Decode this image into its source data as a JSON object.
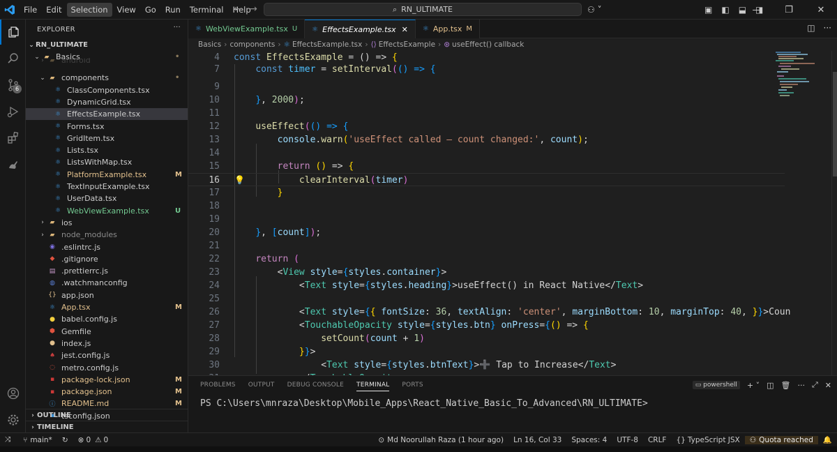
{
  "window": {
    "menu": [
      "File",
      "Edit",
      "Selection",
      "View",
      "Go",
      "Run",
      "Terminal",
      "Help"
    ],
    "menu_active": "Selection",
    "command_center": "RN_ULTIMATE"
  },
  "activity_bar": {
    "source_control_badge": "6"
  },
  "sidebar": {
    "title": "EXPLORER",
    "root": "RN_ULTIMATE",
    "items": [
      {
        "label": "Basics",
        "status": "•",
        "kind": "folder",
        "state": "open"
      },
      {
        "label": "android",
        "status": "",
        "kind": "folder",
        "state": "closed"
      },
      {
        "label": "components",
        "status": "•",
        "kind": "folder",
        "state": "open"
      },
      {
        "label": "ClassComponents.tsx",
        "status": "",
        "kind": "tsx"
      },
      {
        "label": "DynamicGrid.tsx",
        "status": "",
        "kind": "tsx"
      },
      {
        "label": "EffectsExample.tsx",
        "status": "",
        "kind": "tsx"
      },
      {
        "label": "Forms.tsx",
        "status": "",
        "kind": "tsx"
      },
      {
        "label": "GridItem.tsx",
        "status": "",
        "kind": "tsx"
      },
      {
        "label": "Lists.tsx",
        "status": "",
        "kind": "tsx"
      },
      {
        "label": "ListsWithMap.tsx",
        "status": "",
        "kind": "tsx"
      },
      {
        "label": "PlatformExample.tsx",
        "status": "M",
        "kind": "tsx"
      },
      {
        "label": "TextInputExample.tsx",
        "status": "",
        "kind": "tsx"
      },
      {
        "label": "UserData.tsx",
        "status": "",
        "kind": "tsx"
      },
      {
        "label": "WebViewExample.tsx",
        "status": "U",
        "kind": "tsx"
      },
      {
        "label": "ios",
        "status": "",
        "kind": "folder",
        "state": "closed"
      },
      {
        "label": "node_modules",
        "status": "",
        "kind": "folder",
        "state": "closed"
      },
      {
        "label": ".eslintrc.js",
        "status": "",
        "kind": "eslint"
      },
      {
        "label": ".gitignore",
        "status": "",
        "kind": "git"
      },
      {
        "label": ".prettierrc.js",
        "status": "",
        "kind": "prettier"
      },
      {
        "label": ".watchmanconfig",
        "status": "",
        "kind": "watchman"
      },
      {
        "label": "app.json",
        "status": "",
        "kind": "json"
      },
      {
        "label": "App.tsx",
        "status": "M",
        "kind": "tsx"
      },
      {
        "label": "babel.config.js",
        "status": "",
        "kind": "babel"
      },
      {
        "label": "Gemfile",
        "status": "",
        "kind": "ruby"
      },
      {
        "label": "index.js",
        "status": "",
        "kind": "js"
      },
      {
        "label": "jest.config.js",
        "status": "",
        "kind": "jest"
      },
      {
        "label": "metro.config.js",
        "status": "",
        "kind": "metro"
      },
      {
        "label": "package-lock.json",
        "status": "M",
        "kind": "npm"
      },
      {
        "label": "package.json",
        "status": "M",
        "kind": "npm"
      },
      {
        "label": "README.md",
        "status": "M",
        "kind": "md"
      },
      {
        "label": "tsconfig.json",
        "status": "",
        "kind": "ts"
      }
    ],
    "sections": [
      "OUTLINE",
      "TIMELINE"
    ]
  },
  "tabs": [
    {
      "label": "WebViewExample.tsx",
      "status": "U",
      "active": false
    },
    {
      "label": "EffectsExample.tsx",
      "status": "",
      "active": true
    },
    {
      "label": "App.tsx",
      "status": "M",
      "active": false
    }
  ],
  "breadcrumb": [
    "Basics",
    "components",
    "EffectsExample.tsx",
    "EffectsExample",
    "useEffect() callback"
  ],
  "editor": {
    "lines": [
      {
        "n": "4",
        "t": [
          [
            "k",
            "const "
          ],
          [
            "f",
            "EffectsExample"
          ],
          [
            "p",
            " = () => "
          ],
          [
            "y",
            "{"
          ]
        ]
      },
      {
        "n": "7",
        "t": [
          [
            "p",
            "    "
          ],
          [
            "k",
            "const "
          ],
          [
            "c",
            "timer"
          ],
          [
            "p",
            " = "
          ],
          [
            "f",
            "setInterval"
          ],
          [
            "pk",
            "("
          ],
          [
            "b",
            "() => "
          ],
          [
            "b",
            "{"
          ]
        ]
      },
      {
        "n": "9",
        "t": [
          [
            "p",
            ""
          ]
        ]
      },
      {
        "n": "10",
        "t": [
          [
            "p",
            "    "
          ],
          [
            "b",
            "}"
          ],
          [
            "p",
            ", "
          ],
          [
            "n",
            "2000"
          ],
          [
            "pk",
            ")"
          ],
          [
            "p",
            ";"
          ]
        ]
      },
      {
        "n": "11",
        "t": [
          [
            "p",
            ""
          ]
        ]
      },
      {
        "n": "12",
        "t": [
          [
            "p",
            "    "
          ],
          [
            "f",
            "useEffect"
          ],
          [
            "pk",
            "("
          ],
          [
            "b",
            "() => "
          ],
          [
            "b",
            "{"
          ]
        ]
      },
      {
        "n": "13",
        "t": [
          [
            "p",
            "        "
          ],
          [
            "v",
            "console"
          ],
          [
            "p",
            "."
          ],
          [
            "f",
            "warn"
          ],
          [
            "y",
            "("
          ],
          [
            "s",
            "'useEffect called — count changed:'"
          ],
          [
            "p",
            ", "
          ],
          [
            "v",
            "count"
          ],
          [
            "y",
            ")"
          ],
          [
            "p",
            ";"
          ]
        ]
      },
      {
        "n": "14",
        "t": [
          [
            "p",
            ""
          ]
        ]
      },
      {
        "n": "15",
        "t": [
          [
            "p",
            "        "
          ],
          [
            "kc",
            "return "
          ],
          [
            "y",
            "()"
          ],
          [
            "p",
            " => "
          ],
          [
            "y",
            "{"
          ]
        ]
      },
      {
        "n": "16",
        "t": [
          [
            "p",
            "            "
          ],
          [
            "f",
            "clearInterval"
          ],
          [
            "pk",
            "("
          ],
          [
            "v",
            "timer"
          ],
          [
            "pk",
            ")"
          ]
        ]
      },
      {
        "n": "17",
        "t": [
          [
            "p",
            "        "
          ],
          [
            "y",
            "}"
          ]
        ]
      },
      {
        "n": "18",
        "t": [
          [
            "p",
            ""
          ]
        ]
      },
      {
        "n": "19",
        "t": [
          [
            "p",
            ""
          ]
        ]
      },
      {
        "n": "20",
        "t": [
          [
            "p",
            "    "
          ],
          [
            "b",
            "}"
          ],
          [
            "p",
            ", "
          ],
          [
            "b",
            "["
          ],
          [
            "v",
            "count"
          ],
          [
            "b",
            "]"
          ],
          [
            "pk",
            ")"
          ],
          [
            "p",
            ";"
          ]
        ]
      },
      {
        "n": "21",
        "t": [
          [
            "p",
            ""
          ]
        ]
      },
      {
        "n": "22",
        "t": [
          [
            "p",
            "    "
          ],
          [
            "kc",
            "return "
          ],
          [
            "pk",
            "("
          ]
        ]
      },
      {
        "n": "23",
        "t": [
          [
            "p",
            "        "
          ],
          [
            "p",
            "<"
          ],
          [
            "t",
            "View "
          ],
          [
            "v",
            "style"
          ],
          [
            "p",
            "="
          ],
          [
            "b",
            "{"
          ],
          [
            "v",
            "styles"
          ],
          [
            "p",
            "."
          ],
          [
            "v",
            "container"
          ],
          [
            "b",
            "}"
          ],
          [
            "p",
            ">"
          ]
        ]
      },
      {
        "n": "24",
        "t": [
          [
            "p",
            "            <"
          ],
          [
            "t",
            "Text "
          ],
          [
            "v",
            "style"
          ],
          [
            "p",
            "="
          ],
          [
            "b",
            "{"
          ],
          [
            "v",
            "styles"
          ],
          [
            "p",
            "."
          ],
          [
            "v",
            "heading"
          ],
          [
            "b",
            "}"
          ],
          [
            "p",
            ">useEffect() in React Native</"
          ],
          [
            "t",
            "Text"
          ],
          [
            "p",
            ">"
          ]
        ]
      },
      {
        "n": "25",
        "t": [
          [
            "p",
            ""
          ]
        ]
      },
      {
        "n": "26",
        "t": [
          [
            "p",
            "            <"
          ],
          [
            "t",
            "Text "
          ],
          [
            "v",
            "style"
          ],
          [
            "p",
            "="
          ],
          [
            "b",
            "{"
          ],
          [
            "y",
            "{ "
          ],
          [
            "v",
            "fontSize"
          ],
          [
            "p",
            ": "
          ],
          [
            "n",
            "36"
          ],
          [
            "p",
            ", "
          ],
          [
            "v",
            "textAlign"
          ],
          [
            "p",
            ": "
          ],
          [
            "s",
            "'center'"
          ],
          [
            "p",
            ", "
          ],
          [
            "v",
            "marginBottom"
          ],
          [
            "p",
            ": "
          ],
          [
            "n",
            "10"
          ],
          [
            "p",
            ", "
          ],
          [
            "v",
            "marginTop"
          ],
          [
            "p",
            ": "
          ],
          [
            "n",
            "40"
          ],
          [
            "p",
            ", "
          ],
          [
            "y",
            "}"
          ],
          [
            "b",
            "}"
          ],
          [
            "p",
            ">Coun"
          ]
        ]
      },
      {
        "n": "27",
        "t": [
          [
            "p",
            "            <"
          ],
          [
            "t",
            "TouchableOpacity "
          ],
          [
            "v",
            "style"
          ],
          [
            "p",
            "="
          ],
          [
            "b",
            "{"
          ],
          [
            "v",
            "styles"
          ],
          [
            "p",
            "."
          ],
          [
            "v",
            "btn"
          ],
          [
            "b",
            "}"
          ],
          [
            "p",
            " "
          ],
          [
            "v",
            "onPress"
          ],
          [
            "p",
            "="
          ],
          [
            "b",
            "{"
          ],
          [
            "y",
            "()"
          ],
          [
            "p",
            " => "
          ],
          [
            "y",
            "{"
          ]
        ]
      },
      {
        "n": "28",
        "t": [
          [
            "p",
            "                "
          ],
          [
            "f",
            "setCount"
          ],
          [
            "pk",
            "("
          ],
          [
            "v",
            "count"
          ],
          [
            "p",
            " + "
          ],
          [
            "n",
            "1"
          ],
          [
            "pk",
            ")"
          ]
        ]
      },
      {
        "n": "29",
        "t": [
          [
            "p",
            "            "
          ],
          [
            "y",
            "}"
          ],
          [
            "b",
            "}"
          ],
          [
            "p",
            ">"
          ]
        ]
      },
      {
        "n": "30",
        "t": [
          [
            "p",
            "                <"
          ],
          [
            "t",
            "Text "
          ],
          [
            "v",
            "style"
          ],
          [
            "p",
            "="
          ],
          [
            "b",
            "{"
          ],
          [
            "v",
            "styles"
          ],
          [
            "p",
            "."
          ],
          [
            "v",
            "btnText"
          ],
          [
            "b",
            "}"
          ],
          [
            "p",
            ">"
          ],
          [
            "kc",
            "➕"
          ],
          [
            "p",
            " Tap to Increase</"
          ],
          [
            "t",
            "Text"
          ],
          [
            "p",
            ">"
          ]
        ]
      },
      {
        "n": "31",
        "t": [
          [
            "p",
            "            </"
          ],
          [
            "t",
            "TouchableOpacity"
          ],
          [
            "p",
            ">"
          ]
        ]
      }
    ],
    "cursor_line": "16"
  },
  "panel": {
    "tabs": [
      "PROBLEMS",
      "OUTPUT",
      "DEBUG CONSOLE",
      "TERMINAL",
      "PORTS"
    ],
    "active_tab": "TERMINAL",
    "shell": "powershell",
    "prompt": "PS C:\\Users\\mnraza\\Desktop\\Mobile_Apps\\React_Native_Basic_To_Advanced\\RN_ULTIMATE>"
  },
  "status_bar": {
    "branch": "main*",
    "errors": "0",
    "warnings": "0",
    "blame": "Md Noorullah Raza (1 hour ago)",
    "position": "Ln 16, Col 33",
    "spaces": "Spaces: 4",
    "encoding": "UTF-8",
    "eol": "CRLF",
    "language": "TypeScript JSX",
    "quota": "Quota reached"
  }
}
